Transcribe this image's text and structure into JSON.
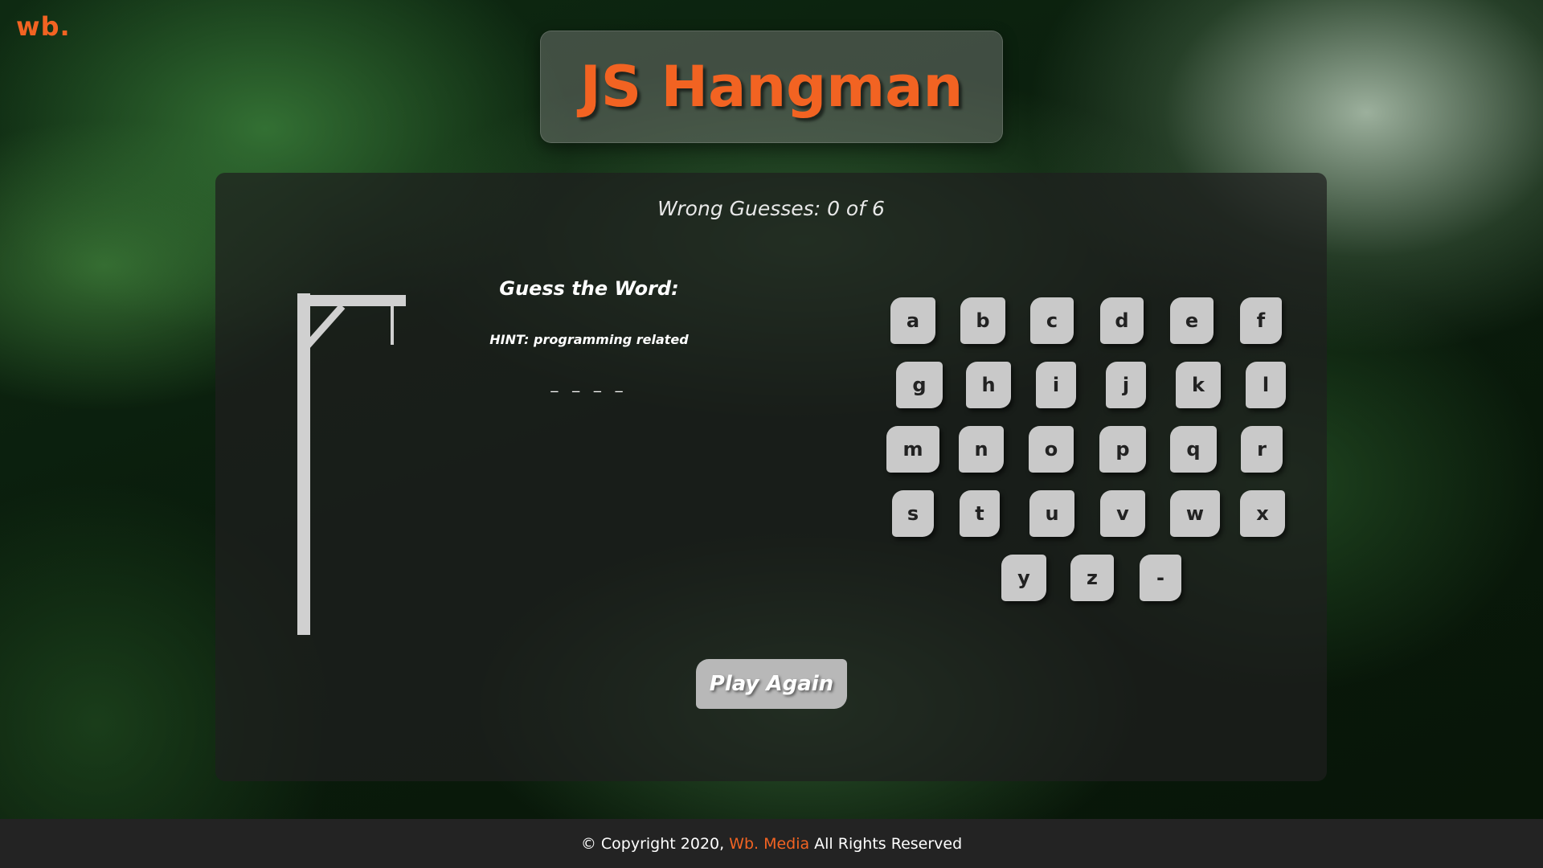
{
  "logo": "wb.",
  "title": "JS Hangman",
  "wrong_guesses": "Wrong Guesses: 0 of 6",
  "guess": {
    "title": "Guess the Word:",
    "hint": "HINT: programming related",
    "word": "_ _ _ _"
  },
  "keyboard": {
    "rows": [
      [
        "a",
        "b",
        "c",
        "d",
        "e",
        "f"
      ],
      [
        "g",
        "h",
        "i",
        "j",
        "k",
        "l"
      ],
      [
        "m",
        "n",
        "o",
        "p",
        "q",
        "r"
      ],
      [
        "s",
        "t",
        "u",
        "v",
        "w",
        "x"
      ],
      [
        "y",
        "z",
        "-"
      ]
    ]
  },
  "play_again": "Play Again",
  "footer": {
    "copyright": "© Copyright 2020,",
    "brand": "Wb. Media",
    "rights": "All Rights Reserved"
  },
  "colors": {
    "accent": "#f26322",
    "key_bg": "#c9c9c9",
    "footer_bg": "#232323"
  }
}
